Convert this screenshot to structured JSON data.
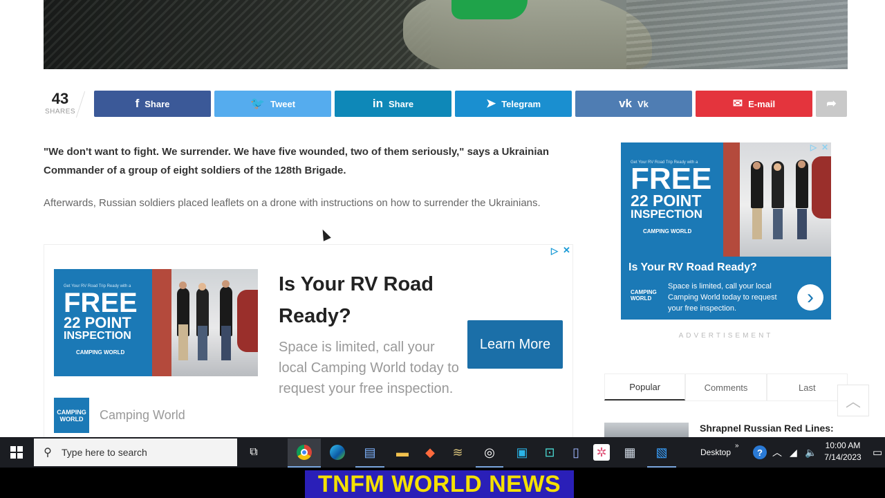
{
  "share_bar": {
    "count": "43",
    "count_label": "SHARES",
    "buttons": [
      {
        "label": "Share",
        "icon": "facebook-icon",
        "glyph": "f",
        "color": "#3b5998"
      },
      {
        "label": "Tweet",
        "icon": "twitter-icon",
        "glyph": "🐦",
        "color": "#55acee"
      },
      {
        "label": "Share",
        "icon": "linkedin-icon",
        "glyph": "in",
        "color": "#0e88b8"
      },
      {
        "label": "Telegram",
        "icon": "telegram-icon",
        "glyph": "➤",
        "color": "#1a8fd0"
      },
      {
        "label": "Vk",
        "icon": "vk-icon",
        "glyph": "vk",
        "color": "#4f7db3"
      },
      {
        "label": "E-mail",
        "icon": "email-icon",
        "glyph": "✉",
        "color": "#e4343d"
      }
    ],
    "more_icon": "share-arrow-icon",
    "more_glyph": "➦",
    "more_color": "#c9c9c9"
  },
  "article": {
    "paragraph1": "\"We don't want to fight. We surrender. We have five wounded, two of them seriously,\" says a Ukrainian Commander of a group of eight soldiers of the 128th Brigade.",
    "paragraph2": "Afterwards, Russian soldiers placed leaflets on a drone with instructions on how to surrender the Ukrainians."
  },
  "inline_ad": {
    "banner_small_top": "Get Your RV Road Trip Ready with a",
    "banner_free": "FREE",
    "banner_point": "22 POINT",
    "banner_inspection": "INSPECTION",
    "banner_brand": "CAMPING WORLD",
    "headline": "Is Your RV Road Ready?",
    "body": "Space is limited, call your local Camping World today to request your free inspection.",
    "cta": "Learn More",
    "advertiser_logo": "CAMPING WORLD",
    "advertiser": "Camping World"
  },
  "side_ad": {
    "small_top": "Get Your RV Road Trip Ready with a",
    "free": "FREE",
    "point": "22 POINT",
    "inspection": "INSPECTION",
    "brand": "CAMPING WORLD",
    "headline": "Is Your RV Road Ready?",
    "logo": "CAMPING WORLD",
    "body": "Space is limited, call your local Camping World today to request your free inspection.",
    "arrow": "›",
    "label": "ADVERTISEMENT"
  },
  "sidebar": {
    "tabs": [
      "Popular",
      "Comments",
      "Last"
    ],
    "headline": "Shrapnel Russian Red Lines:"
  },
  "taskbar": {
    "search_placeholder": "Type here to search",
    "desktop_label": "Desktop",
    "time": "10:00 AM",
    "date": "7/14/2023"
  },
  "overlay": {
    "title": "TNFM WORLD NEWS"
  }
}
